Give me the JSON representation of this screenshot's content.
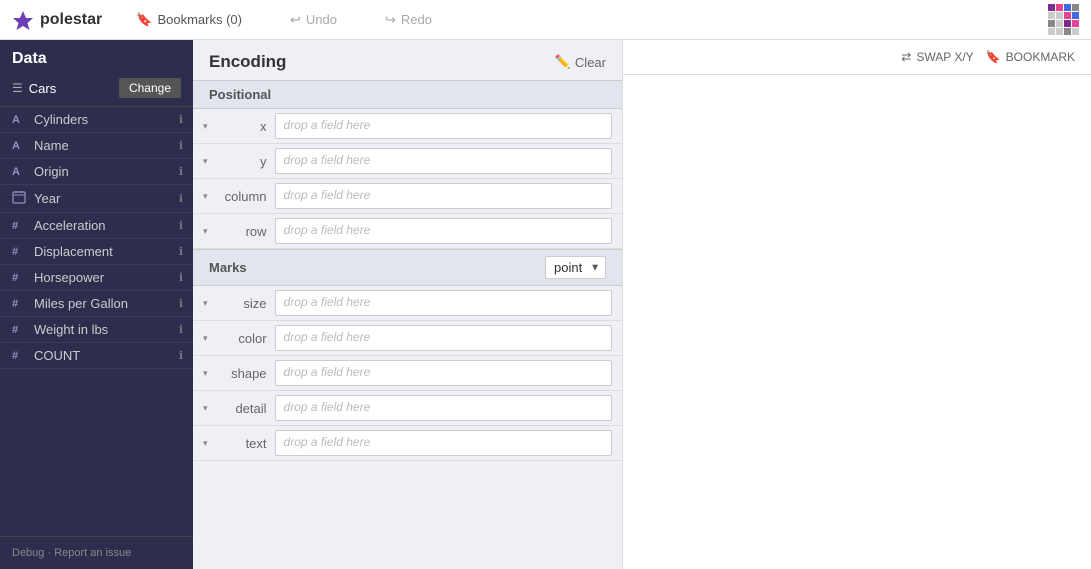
{
  "topbar": {
    "logo_text": "polestar",
    "bookmarks_label": "Bookmarks (0)",
    "undo_label": "Undo",
    "redo_label": "Redo"
  },
  "sidebar": {
    "title": "Data",
    "dataset_name": "Cars",
    "change_button": "Change",
    "fields": [
      {
        "type": "A",
        "name": "Cylinders",
        "type_label": "A"
      },
      {
        "type": "A",
        "name": "Name",
        "type_label": "A"
      },
      {
        "type": "A",
        "name": "Origin",
        "type_label": "A"
      },
      {
        "type": "cal",
        "name": "Year",
        "type_label": "📅"
      },
      {
        "type": "#",
        "name": "Acceleration",
        "type_label": "#"
      },
      {
        "type": "#",
        "name": "Displacement",
        "type_label": "#"
      },
      {
        "type": "#",
        "name": "Horsepower",
        "type_label": "#"
      },
      {
        "type": "#",
        "name": "Miles per Gallon",
        "type_label": "#"
      },
      {
        "type": "#",
        "name": "Weight in lbs",
        "type_label": "#"
      },
      {
        "type": "#",
        "name": "COUNT",
        "type_label": "#"
      }
    ],
    "footer_debug": "Debug",
    "footer_report": "Report an issue"
  },
  "encoding": {
    "title": "Encoding",
    "clear_label": "Clear",
    "positional_label": "Positional",
    "marks_label": "Marks",
    "marks_value": "point",
    "drop_placeholder": "drop a field here",
    "positional_fields": [
      {
        "label": "x"
      },
      {
        "label": "y"
      },
      {
        "label": "column"
      },
      {
        "label": "row"
      }
    ],
    "marks_fields": [
      {
        "label": "size"
      },
      {
        "label": "color"
      },
      {
        "label": "shape"
      },
      {
        "label": "detail"
      },
      {
        "label": "text"
      }
    ]
  },
  "toolbar": {
    "swap_label": "SWAP X/Y",
    "bookmark_label": "BOOKMARK"
  },
  "grid_colors": [
    "#7b2d8b",
    "#e84393",
    "#4169e1",
    "#888",
    "#ccc",
    "#ccc",
    "#e84393",
    "#4169e1",
    "#888",
    "#ccc",
    "#7b2d8b",
    "#e84393",
    "#ccc",
    "#ccc",
    "#888",
    "#ccc"
  ]
}
